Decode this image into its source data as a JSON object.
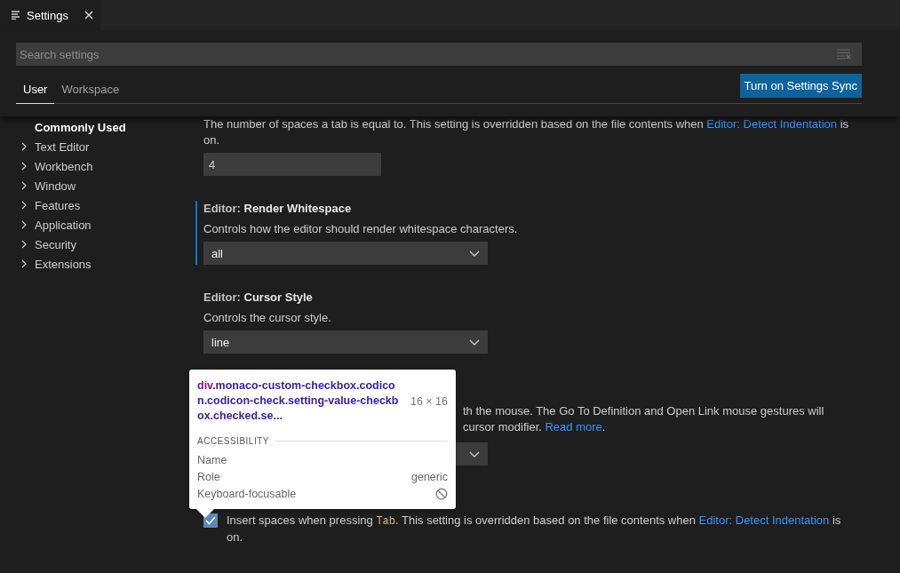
{
  "editor_tab": {
    "title": "Settings",
    "selected": true
  },
  "search": {
    "placeholder": "Search settings"
  },
  "scopes": [
    {
      "label": "User",
      "selected": true
    },
    {
      "label": "Workspace",
      "selected": false
    }
  ],
  "sync_button": "Turn on Settings Sync",
  "toc": [
    {
      "label": "Commonly Used",
      "kind": "leaf",
      "selected": true
    },
    {
      "label": "Text Editor",
      "kind": "group",
      "selected": false
    },
    {
      "label": "Workbench",
      "kind": "group",
      "selected": false
    },
    {
      "label": "Window",
      "kind": "group",
      "selected": false
    },
    {
      "label": "Features",
      "kind": "group",
      "selected": false
    },
    {
      "label": "Application",
      "kind": "group",
      "selected": false
    },
    {
      "label": "Security",
      "kind": "group",
      "selected": false
    },
    {
      "label": "Extensions",
      "kind": "group",
      "selected": false
    }
  ],
  "settings": [
    {
      "kind": "number",
      "focused": false,
      "description": [
        {
          "kind": "text",
          "text": "The number of spaces a tab is equal to. This setting is overridden based on the file contents when "
        },
        {
          "kind": "link",
          "text": "Editor: Detect Indentation"
        },
        {
          "kind": "text",
          "text": " is on."
        }
      ],
      "value": "4"
    },
    {
      "kind": "enum",
      "focused": true,
      "category": "Editor:",
      "name": "Render Whitespace",
      "description": [
        {
          "kind": "text",
          "text": "Controls how the editor should render whitespace characters."
        }
      ],
      "value": "all"
    },
    {
      "kind": "enum",
      "focused": false,
      "category": "Editor:",
      "name": "Cursor Style",
      "description": [
        {
          "kind": "text",
          "text": "Controls the cursor style."
        }
      ],
      "value": "line"
    },
    {
      "kind": "covered",
      "lines": [
        [
          {
            "kind": "text",
            "text": "th the mouse. The Go To Definition and Open Link mouse gestures will"
          }
        ],
        [
          {
            "kind": "text",
            "text": "cursor modifier. "
          },
          {
            "kind": "link",
            "text": "Read more"
          },
          {
            "kind": "text",
            "text": "."
          }
        ]
      ]
    },
    {
      "kind": "checkbox",
      "focused": false,
      "checked": true,
      "description": [
        {
          "kind": "text",
          "text": "Insert spaces when pressing "
        },
        {
          "kind": "code",
          "text": "Tab"
        },
        {
          "kind": "text",
          "text": ". This setting is overridden based on the file contents when "
        },
        {
          "kind": "link",
          "text": "Editor: Detect Indentation"
        },
        {
          "kind": "text",
          "text": " is on."
        }
      ]
    }
  ],
  "inspect_tooltip": {
    "tag": "div",
    "selector": ".monaco-custom-checkbox.codicon.codicon-check.setting-value-checkbox.checked.se...",
    "size": "16 × 16",
    "section": "ACCESSIBILITY",
    "rows": [
      {
        "label": "Name",
        "kind": "empty"
      },
      {
        "label": "Role",
        "kind": "text",
        "value": "generic"
      },
      {
        "label": "Keyboard-focusable",
        "kind": "blocked"
      }
    ]
  }
}
